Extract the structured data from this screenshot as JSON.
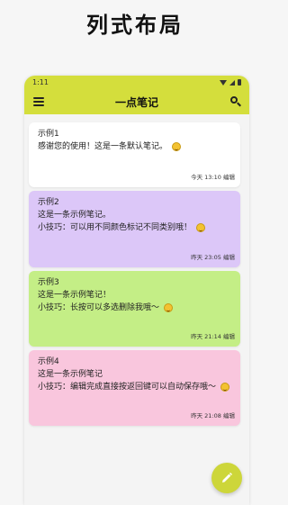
{
  "heading": "列式布局",
  "status_bar": {
    "time": "1:11"
  },
  "app_bar": {
    "title": "一点笔记"
  },
  "notes": [
    {
      "title": "示例1",
      "lines": [
        "感谢您的使用！这是一条默认笔记。"
      ],
      "time": "今天 13:10",
      "edit_label": "编辑",
      "color": "#ffffff"
    },
    {
      "title": "示例2",
      "lines": [
        "这是一条示例笔记。",
        "小技巧：可以用不同颜色标记不同类别哦！"
      ],
      "time": "昨天 23:05",
      "edit_label": "编辑",
      "color": "#dcc7f8"
    },
    {
      "title": "示例3",
      "lines": [
        "这是一条示例笔记！",
        "小技巧：长按可以多选删除我哦～"
      ],
      "time": "昨天 21:14",
      "edit_label": "编辑",
      "color": "#c4ee86"
    },
    {
      "title": "示例4",
      "lines": [
        "这是一条示例笔记",
        "小技巧：编辑完成直接按返回键可以自动保存哦～"
      ],
      "time": "昨天 21:08",
      "edit_label": "编辑",
      "color": "#f9c6dd"
    }
  ],
  "colors": {
    "accent": "#d4de3c",
    "fab": "#cdd63a"
  },
  "icons": {
    "menu": "menu-icon",
    "search": "search-icon",
    "fab": "pencil-icon",
    "emoji": "smiley-icon"
  }
}
